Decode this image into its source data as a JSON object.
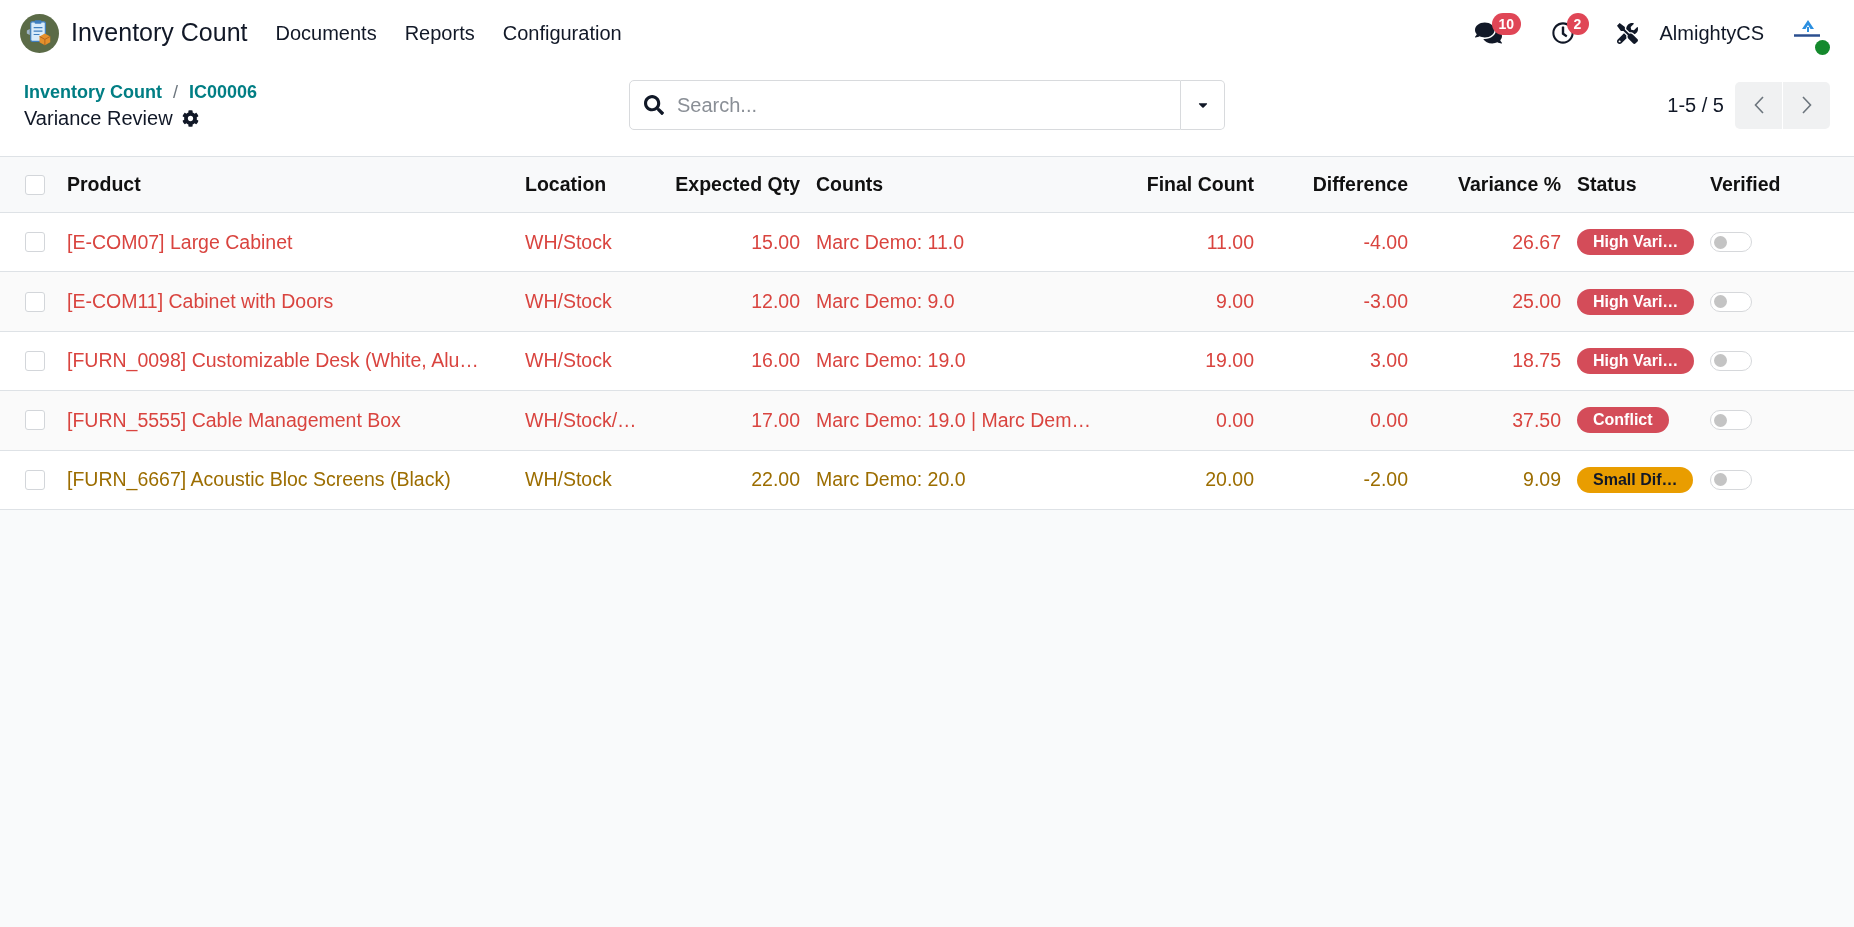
{
  "navbar": {
    "app_name": "Inventory Count",
    "menus": [
      "Documents",
      "Reports",
      "Configuration"
    ],
    "messages_count": "10",
    "activities_count": "2",
    "company": "AlmightyCS"
  },
  "breadcrumb": {
    "items": [
      "Inventory Count",
      "IC00006"
    ],
    "separator": "/",
    "current": "Variance Review"
  },
  "search": {
    "placeholder": "Search..."
  },
  "pager": {
    "range": "1-5 / 5"
  },
  "table": {
    "all_selected": false,
    "columns": [
      "Product",
      "Location",
      "Expected Qty",
      "Counts",
      "Final Count",
      "Difference",
      "Variance %",
      "Status",
      "Verified"
    ],
    "rows": [
      {
        "selected": false,
        "kind": "danger",
        "product": "[E-COM07] Large Cabinet",
        "location": "WH/Stock",
        "expected_qty": "15.00",
        "counts": "Marc Demo: 11.0",
        "final_count": "11.00",
        "difference": "-4.00",
        "variance_pct": "26.67",
        "status": {
          "label": "High Vari…",
          "color": "#d44c59"
        },
        "verified": false
      },
      {
        "selected": false,
        "kind": "danger",
        "product": "[E-COM11] Cabinet with Doors",
        "location": "WH/Stock",
        "expected_qty": "12.00",
        "counts": "Marc Demo: 9.0",
        "final_count": "9.00",
        "difference": "-3.00",
        "variance_pct": "25.00",
        "status": {
          "label": "High Vari…",
          "color": "#d44c59"
        },
        "verified": false
      },
      {
        "selected": false,
        "kind": "danger",
        "product": "[FURN_0098] Customizable Desk (White, Alu…",
        "location": "WH/Stock",
        "expected_qty": "16.00",
        "counts": "Marc Demo: 19.0",
        "final_count": "19.00",
        "difference": "3.00",
        "variance_pct": "18.75",
        "status": {
          "label": "High Vari…",
          "color": "#d44c59"
        },
        "verified": false
      },
      {
        "selected": false,
        "kind": "danger",
        "product": "[FURN_5555] Cable Management Box",
        "location": "WH/Stock/…",
        "expected_qty": "17.00",
        "counts": "Marc Demo: 19.0 | Marc Dem…",
        "final_count": "0.00",
        "difference": "0.00",
        "variance_pct": "37.50",
        "status": {
          "label": "Conflict",
          "color": "#d44c59"
        },
        "verified": false
      },
      {
        "selected": false,
        "kind": "warning",
        "product": "[FURN_6667] Acoustic Bloc Screens (Black)",
        "location": "WH/Stock",
        "expected_qty": "22.00",
        "counts": "Marc Demo: 20.0",
        "final_count": "20.00",
        "difference": "-2.00",
        "variance_pct": "9.09",
        "status": {
          "label": "Small Dif…",
          "color": "#e99d00"
        },
        "verified": false
      }
    ]
  }
}
